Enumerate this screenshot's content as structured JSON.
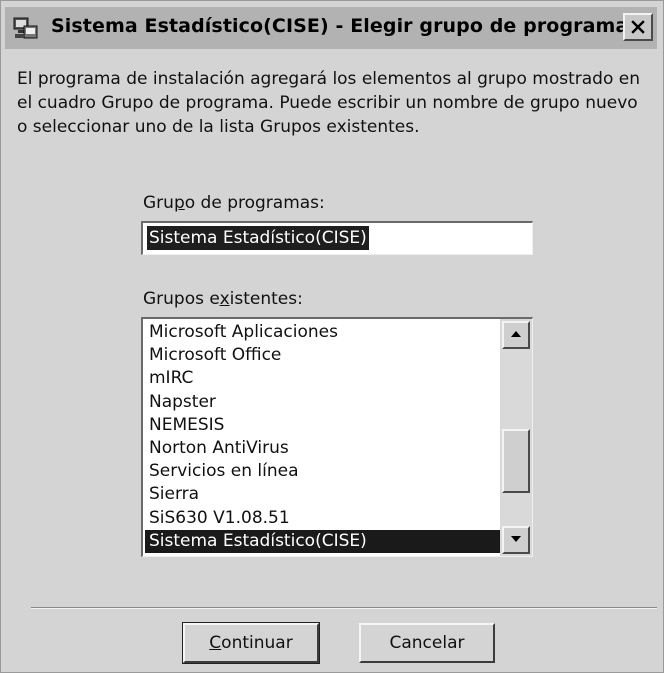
{
  "window": {
    "title": "Sistema Estadístico(CISE) - Elegir grupo de programas"
  },
  "description": "El programa de instalación agregará los elementos al grupo mostrado en el cuadro Grupo de programa. Puede escribir un nombre de grupo nuevo o seleccionar uno de la lista Grupos existentes.",
  "program_group": {
    "label_pre": "Gru",
    "label_accel": "p",
    "label_post": "o de programas:",
    "value": "Sistema Estadístico(CISE)"
  },
  "existing_groups": {
    "label_pre": "Grupos e",
    "label_accel": "x",
    "label_post": "istentes:",
    "items": [
      "Microsoft Aplicaciones",
      "Microsoft Office",
      "mIRC",
      "Napster",
      "NEMESIS",
      "Norton AntiVirus",
      "Servicios en línea",
      "Sierra",
      "SiS630 V1.08.51",
      "Sistema Estadístico(CISE)"
    ],
    "selected_item": "Sistema Estadístico(CISE)",
    "scroll_position": 0.72
  },
  "buttons": {
    "continue_accel": "C",
    "continue_rest": "ontinuar",
    "cancel": "Cancelar"
  },
  "colors": {
    "selection": "#1a1a1a",
    "dialog_bg": "#d4d4d4"
  },
  "icons": {
    "title": "installer-computer-icon",
    "close": "close-icon",
    "scroll_up": "arrow-up-icon",
    "scroll_down": "arrow-down-icon"
  }
}
